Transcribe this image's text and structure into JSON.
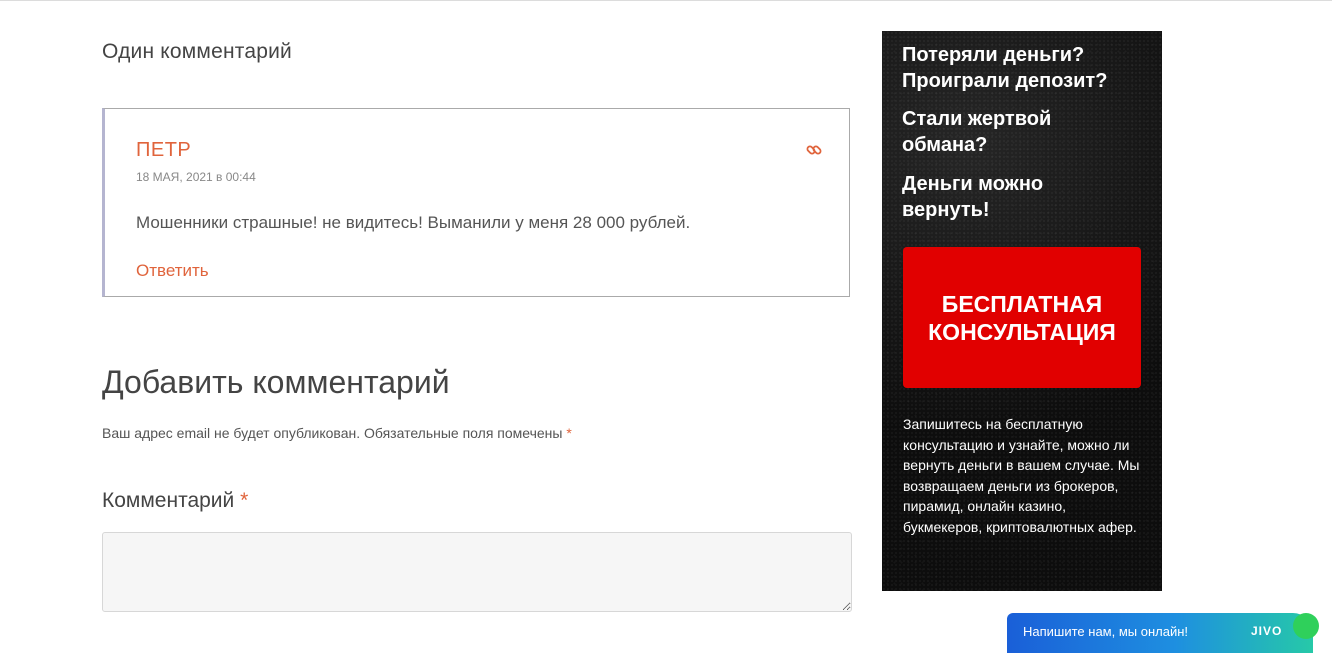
{
  "comments": {
    "title": "Один комментарий",
    "items": [
      {
        "author": "ПЕТР",
        "date": "18 МАЯ, 2021 в 00:44",
        "text": "Мошенники страшные! не видитесь! Выманили у меня 28 000 рублей.",
        "reply_label": "Ответить",
        "link_icon": "link-icon"
      }
    ]
  },
  "comment_form": {
    "title": "Добавить комментарий",
    "notes": "Ваш адрес email не будет опубликован. Обязательные поля помечены",
    "required_mark": "*",
    "comment_label": "Комментарий",
    "comment_value": ""
  },
  "ad": {
    "heading1_line1": "Потеряли деньги?",
    "heading1_line2": "Проиграли депозит?",
    "heading2_line1": "Стали жертвой",
    "heading2_line2": "обмана?",
    "heading3_line1": "Деньги можно",
    "heading3_line2": "вернуть!",
    "button_line1": "БЕСПЛАТНАЯ",
    "button_line2": "КОНСУЛЬТАЦИЯ",
    "body": "Запишитесь на бесплатную консультацию и узнайте, можно ли вернуть деньги в вашем случае. Мы возвращаем деньги из брокеров, пирамид, онлайн казино, букмекеров, криптовалютных афер.",
    "button_color": "#e10000"
  },
  "chat_widget": {
    "text": "Напишите нам, мы онлайн!",
    "brand": "JIVO"
  },
  "colors": {
    "accent": "#e0643c",
    "text": "#555555",
    "heading": "#444444"
  }
}
